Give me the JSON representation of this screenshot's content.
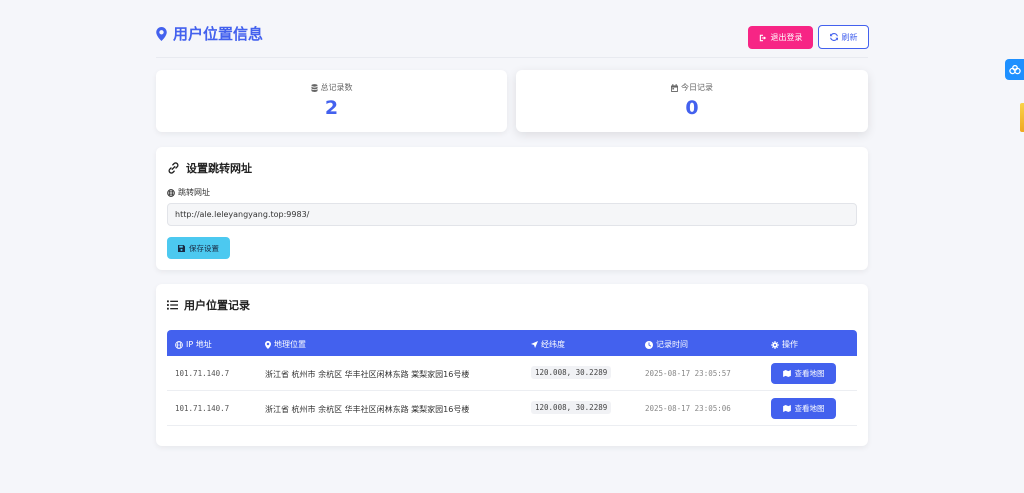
{
  "header": {
    "title": "用户位置信息",
    "logout_label": "退出登录",
    "refresh_label": "刷新"
  },
  "stats": [
    {
      "label": "总记录数",
      "value": "2",
      "icon": "database-icon"
    },
    {
      "label": "今日记录",
      "value": "0",
      "icon": "calendar-icon"
    }
  ],
  "redirect": {
    "title": "设置跳转网址",
    "field_label": "跳转网址",
    "url_value": "http://ale.leleyangyang.top:9983/",
    "save_label": "保存设置"
  },
  "records": {
    "title": "用户位置记录",
    "columns": [
      "IP 地址",
      "地理位置",
      "经纬度",
      "记录时间",
      "操作"
    ],
    "rows": [
      {
        "ip": "101.71.140.7",
        "location": "浙江省 杭州市 余杭区 华丰社区闲林东路 棠梨家园16号楼",
        "coords": "120.008, 30.2289",
        "time": "2025-08-17 23:05:57",
        "action": "查看地图"
      },
      {
        "ip": "101.71.140.7",
        "location": "浙江省 杭州市 余杭区 华丰社区闲林东路 棠梨家园16号楼",
        "coords": "120.008, 30.2289",
        "time": "2025-08-17 23:05:06",
        "action": "查看地图"
      }
    ]
  },
  "colors": {
    "primary": "#4361ee",
    "danger": "#f72585",
    "info": "#4cc9f0",
    "background": "#f5f6fa"
  }
}
